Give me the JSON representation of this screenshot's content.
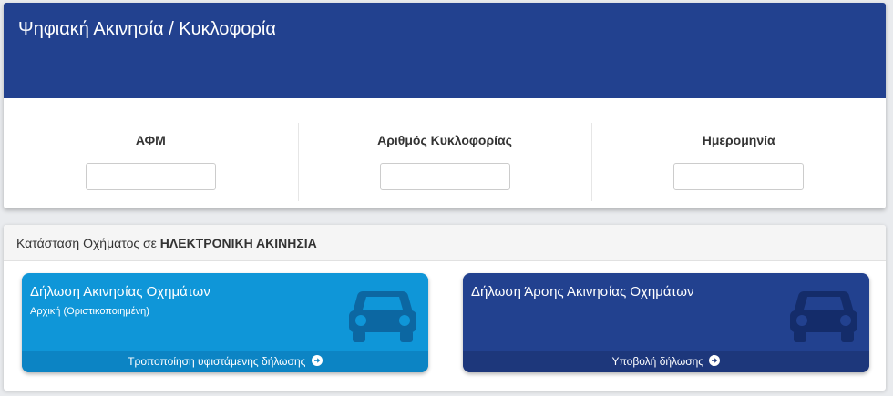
{
  "header": {
    "title": "Ψηφιακή Ακινησία / Κυκλοφορία"
  },
  "fields": [
    {
      "label": "ΑΦΜ",
      "value": ""
    },
    {
      "label": "Αριθμός Κυκλοφορίας",
      "value": ""
    },
    {
      "label": "Ημερομηνία",
      "value": ""
    }
  ],
  "status": {
    "prefix": "Κατάσταση Οχήματος σε",
    "value": "ΗΛΕΚΤΡΟΝΙΚΗ ΑΚΙΝΗΣΙΑ"
  },
  "tiles": [
    {
      "title": "Δήλωση Ακινησίας Οχημάτων",
      "subtitle": "Αρχική (Οριστικοποιημένη)",
      "action": "Τροποποίηση υφιστάμενης δήλωσης",
      "icon": "car-icon",
      "color": "#0f96d8"
    },
    {
      "title": "Δήλωση Άρσης Ακινησίας Οχημάτων",
      "action": "Υποβολή δήλωσης",
      "icon": "car-icon",
      "color": "#22418f"
    }
  ],
  "colors": {
    "header_bg": "#22418f",
    "tile1_bg": "#0f96d8",
    "tile2_bg": "#22418f"
  }
}
